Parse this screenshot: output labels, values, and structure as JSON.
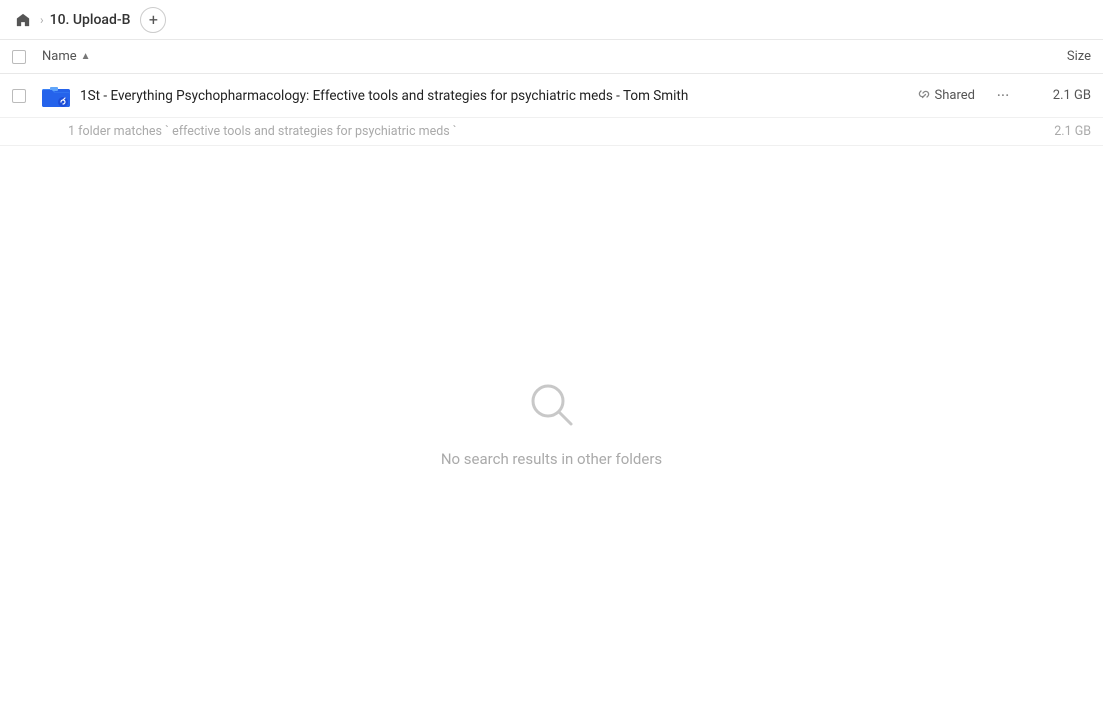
{
  "topbar": {
    "home_icon": "home-icon",
    "breadcrumb_separator": "›",
    "breadcrumb_label": "10. Upload-B",
    "add_button_label": "+"
  },
  "columns": {
    "name_label": "Name",
    "sort_indicator": "▲",
    "size_label": "Size"
  },
  "file_row": {
    "icon": "folder-icon",
    "name": "1St - Everything Psychopharmacology: Effective tools and strategies for psychiatric meds - Tom Smith",
    "shared_label": "Shared",
    "size": "2.1 GB"
  },
  "match_info": {
    "text": "1 folder matches ` effective tools and strategies for psychiatric meds `",
    "size": "2.1 GB"
  },
  "no_results": {
    "icon": "search-icon",
    "text": "No search results in other folders"
  }
}
